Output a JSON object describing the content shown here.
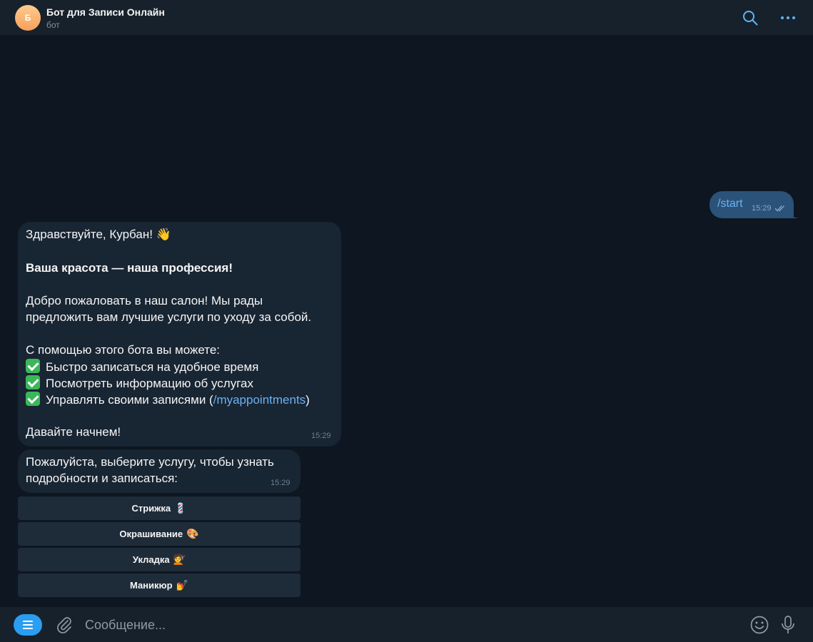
{
  "header": {
    "avatar_letter": "Б",
    "title": "Бот для Записи Онлайн",
    "subtitle": "бот",
    "search_icon": "search-icon",
    "more_icon": "more-dots-icon",
    "accent": "#5eb5f7"
  },
  "outgoing": {
    "text": "/start",
    "time": "15:29",
    "status_icon": "double-check-icon"
  },
  "welcome": {
    "greeting": "Здравствуйте, Курбан! 👋",
    "slogan": "Ваша красота — наша профессия!",
    "intro_1": "Добро пожаловать в наш салон! Мы рады",
    "intro_2": "предложить вам лучшие услуги по уходу за собой.",
    "features_title": "С помощью этого бота вы можете:",
    "feature_1": "Быстро записаться на удобное время",
    "feature_2": "Посмотреть информацию об услугах",
    "feature_3_prefix": "Управлять своими записями (",
    "feature_3_link": "/myappointments",
    "feature_3_suffix": ")",
    "closing": "Давайте начнем!",
    "time": "15:29"
  },
  "prompt": {
    "line_1": "Пожалуйста, выберите услугу, чтобы узнать",
    "line_2": "подробности и записаться:",
    "time": "15:29"
  },
  "keyboard": [
    {
      "label": "Стрижка",
      "emoji": "💈"
    },
    {
      "label": "Окрашивание",
      "emoji": "🎨"
    },
    {
      "label": "Укладка",
      "emoji": "💇"
    },
    {
      "label": "Маникюр",
      "emoji": "💅"
    }
  ],
  "composer": {
    "menu_icon": "menu-icon",
    "attach_icon": "paperclip-icon",
    "placeholder": "Сообщение...",
    "emoji_icon": "smiley-icon",
    "mic_icon": "microphone-icon"
  },
  "colors": {
    "background": "#0e1621",
    "panel": "#17212b",
    "incoming_bubble": "#182533",
    "outgoing_bubble": "#2b5278",
    "link": "#6ab2f2",
    "menu_button": "#2a9ef1"
  }
}
